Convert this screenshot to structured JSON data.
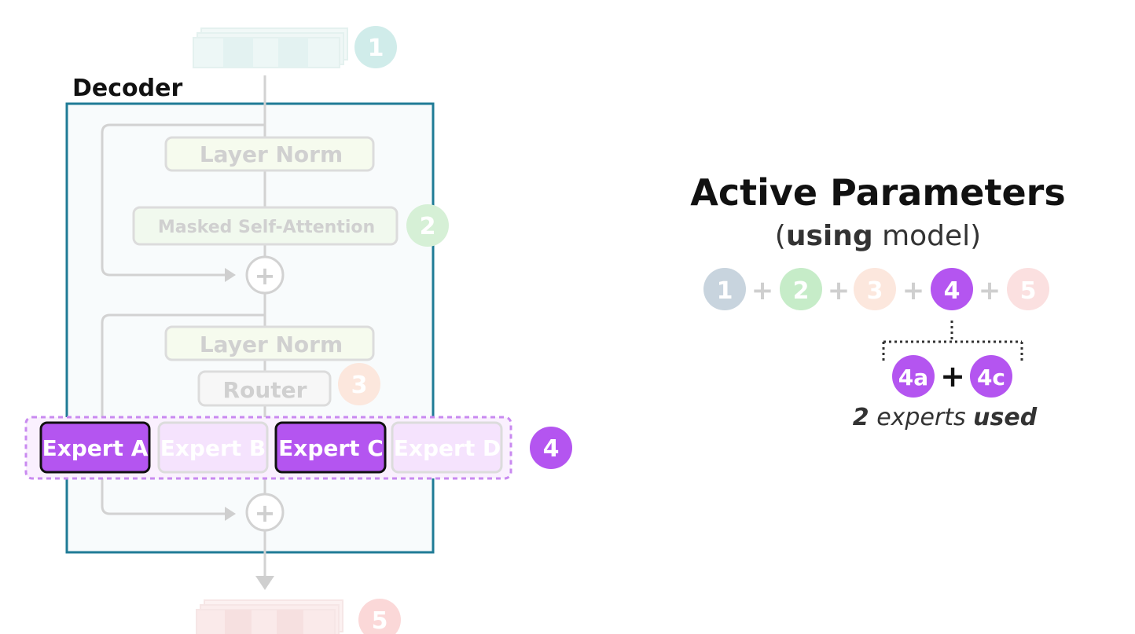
{
  "decoder": {
    "title": "Decoder",
    "layer_norm_top": "Layer Norm",
    "masked_self_attention": "Masked Self-Attention",
    "layer_norm_bottom": "Layer Norm",
    "router": "Router",
    "experts": [
      "Expert A",
      "Expert B",
      "Expert C",
      "Expert D"
    ],
    "plus": "+"
  },
  "badges": {
    "b1": "1",
    "b2": "2",
    "b3": "3",
    "b4": "4",
    "b5": "5"
  },
  "active_parameters": {
    "title": "Active Parameters",
    "paren_open": "(",
    "subtitle_bold": "using",
    "subtitle_rest": " model)",
    "equation": [
      "1",
      "+",
      "2",
      "+",
      "3",
      "+",
      "4",
      "+",
      "5"
    ],
    "expert_a": "4a",
    "expert_plus": "+",
    "expert_c": "4c",
    "caption_count": "2",
    "caption_middle": " experts ",
    "caption_end": "used"
  },
  "colors": {
    "decoder_border": "#1f7b96",
    "expert_purple": "#b455f0",
    "badge1": "#c8d4de",
    "badge2": "#c6ecc8",
    "badge3": "#fbe3d8",
    "badge4": "#b455f0",
    "badge5": "#fbd8d8"
  }
}
